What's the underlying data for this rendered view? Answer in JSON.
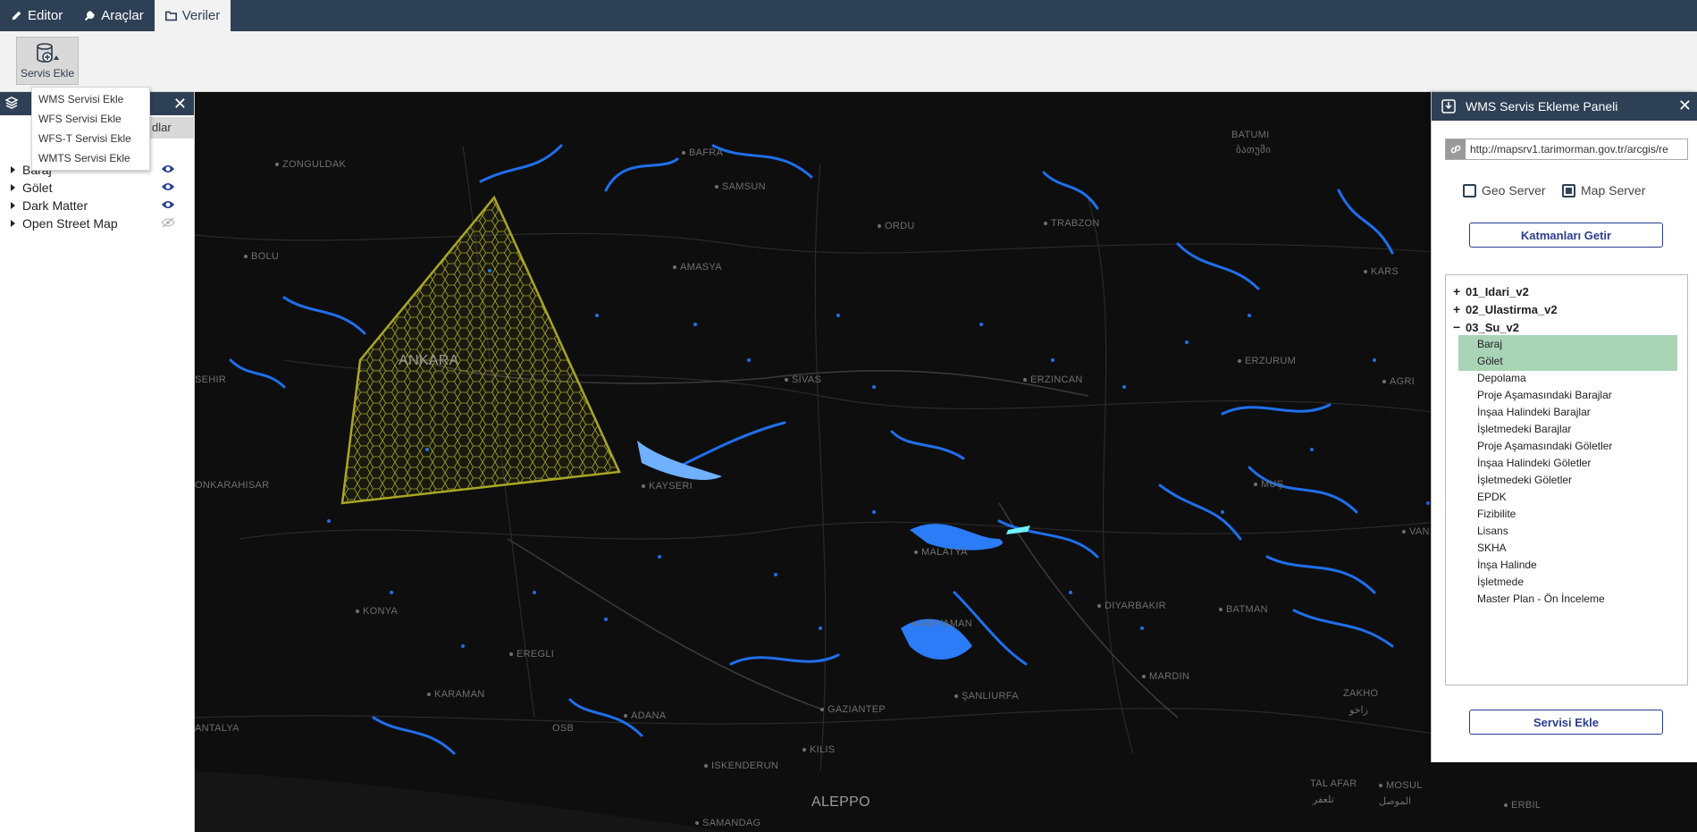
{
  "nav": {
    "tabs": [
      {
        "label": "Editor",
        "icon": "pencil-icon"
      },
      {
        "label": "Araçlar",
        "icon": "wrench-icon"
      },
      {
        "label": "Veriler",
        "icon": "folder-icon"
      }
    ],
    "active": "Veriler"
  },
  "ribbon": {
    "servis_ekle_label": "Servis Ekle",
    "menu": [
      "WMS Servisi Ekle",
      "WFS Servisi Ekle",
      "WFS-T Servisi Ekle",
      "WMTS Servisi Ekle"
    ]
  },
  "layer_panel": {
    "tab_label": "dlar",
    "layers": [
      {
        "name": "Baraj",
        "visible": true
      },
      {
        "name": "Gölet",
        "visible": true
      },
      {
        "name": "Dark Matter",
        "visible": true
      },
      {
        "name": "Open Street Map",
        "visible": false
      }
    ]
  },
  "map": {
    "cities": [
      "ZONGULDAK",
      "BAFRA",
      "BATUMI",
      "ბათუმი",
      "SAMSUN",
      "BOLU",
      "ORDU",
      "TRABZON",
      "AMASYA",
      "KARS",
      "ANKARA",
      "ERZURUM",
      "SEHIR",
      "SIVAS",
      "ERZINCAN",
      "AGRI",
      "KAYSERI",
      "MUŞ",
      "VAN",
      "ONKARAHISAR",
      "MALATYA",
      "DIYARBAKIR",
      "BATMAN",
      "KONYA",
      "ADIYAMAN",
      "EREGLI",
      "MARDIN",
      "KARAMAN",
      "GAZIANTEP",
      "ŞANLIURFA",
      "ZAKHO",
      "زاخو",
      "ADANA",
      "ANTALYA",
      "OSB",
      "KILIS",
      "ISKENDERUN",
      "TAL AFAR",
      "تلعفر",
      "MOSUL",
      "الموصل",
      "ERBIL",
      "ALEPPO",
      "SAMANDAG"
    ]
  },
  "wms_panel": {
    "title": "WMS Servis Ekleme Paneli",
    "url": "http://mapsrv1.tarimorman.gov.tr/arcgis/re",
    "server_types": [
      {
        "label": "Geo Server",
        "selected": false
      },
      {
        "label": "Map Server",
        "selected": true
      }
    ],
    "fetch_button": "Katmanları Getir",
    "add_button": "Servisi Ekle",
    "tree": {
      "groups": [
        {
          "label": "01_Idari_v2",
          "expanded": false
        },
        {
          "label": "02_Ulastirma_v2",
          "expanded": false
        },
        {
          "label": "03_Su_v2",
          "expanded": true
        }
      ],
      "leaves": [
        {
          "label": "Baraj",
          "selected": true
        },
        {
          "label": "Gölet",
          "selected": true
        },
        {
          "label": "Depolama",
          "selected": false
        },
        {
          "label": "Proje Aşamasındaki Barajlar",
          "selected": false
        },
        {
          "label": "İnşaa Halindeki Barajlar",
          "selected": false
        },
        {
          "label": "İşletmedeki Barajlar",
          "selected": false
        },
        {
          "label": " Proje Aşamasındaki Göletler",
          "selected": false
        },
        {
          "label": "İnşaa Halindeki Göletler",
          "selected": false
        },
        {
          "label": "İşletmedeki Göletler",
          "selected": false
        },
        {
          "label": "EPDK",
          "selected": false
        },
        {
          "label": "Fizibilite",
          "selected": false
        },
        {
          "label": "Lisans",
          "selected": false
        },
        {
          "label": "SKHA",
          "selected": false
        },
        {
          "label": "İnşa Halinde",
          "selected": false
        },
        {
          "label": "İşletmede",
          "selected": false
        },
        {
          "label": "Master Plan - Ön İnceleme",
          "selected": false
        }
      ]
    }
  },
  "colors": {
    "nav_bg": "#2e4055",
    "water": "#1f6feb",
    "polygon_stroke": "#a9a723",
    "selected_row": "#a9d4b6"
  }
}
